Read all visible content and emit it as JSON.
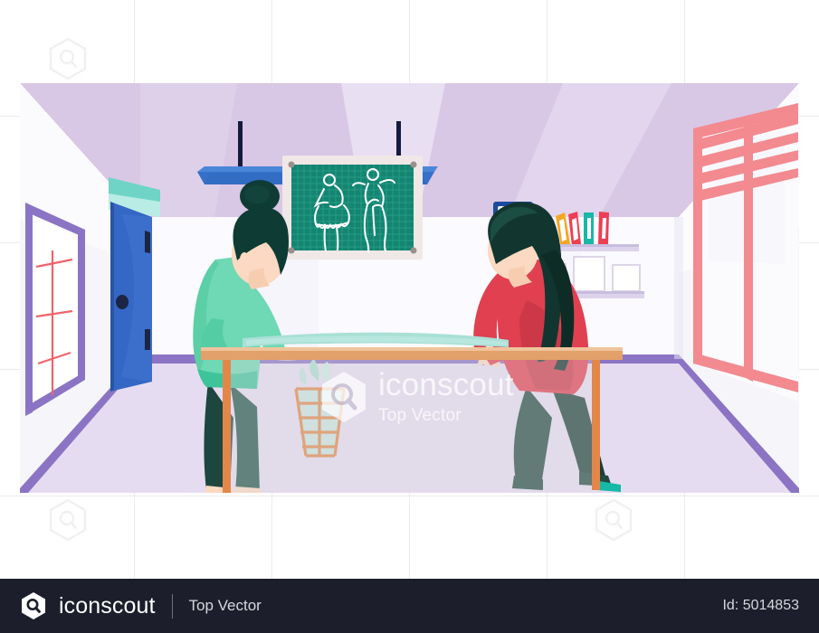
{
  "footer": {
    "logo_icon": "iconscout-hexagon-logo",
    "brand": "iconscout",
    "sub_brand": "Top Vector",
    "id_label": "Id: 5014853"
  },
  "watermark": {
    "logo_icon": "iconscout-hexagon-logo",
    "brand": "iconscout",
    "sub_brand": "Top Vector",
    "tile_icon": "hexagon-magnifier-watermark-icon"
  },
  "illustration": {
    "title": "Fashion design studio with two women at a work table",
    "scene_name": "tailoring-studio-scene",
    "colors": {
      "ceiling": "#d9c7e6",
      "ceiling_light": "#e6dcf0",
      "back_wall": "#fbfbfd",
      "side_wall": "#f4f4f8",
      "floor": "#e2d7ee",
      "floor_trim": "#8b74c4",
      "table_top": "#e2a06a",
      "table_leg": "#e2874a",
      "door": "#3567c4",
      "door_dark": "#2e5bb0",
      "chalkboard": "#1d8f7a",
      "chalkboard_frame": "#efe8e6",
      "window_frame": "#f28a90",
      "lamp": "#3570c9",
      "lamp_rod": "#151b3d",
      "poster_frame": "#8b74c4",
      "poster_marks": "#f0636b",
      "sign": "#7ad9cd"
    },
    "wall_items": [
      {
        "name": "measurement-poster",
        "detail": "purple framed poster with red tick marks"
      },
      {
        "name": "exit-sign",
        "detail": "mint green angled sign above door"
      },
      {
        "name": "studio-door",
        "detail": "blue door with knob and two hinges"
      },
      {
        "name": "design-chalkboard",
        "detail": "teal grid board with two white dress sketches"
      },
      {
        "name": "wall-clock",
        "detail": "square blue framed clock"
      },
      {
        "name": "book-shelf",
        "detail": "shelf with four upright books"
      },
      {
        "name": "frame-shelf",
        "detail": "lower shelf with three white picture frames"
      },
      {
        "name": "studio-window",
        "detail": "pink framed window with blinds"
      },
      {
        "name": "ceiling-lamp",
        "detail": "blue bar lamp on two rods"
      }
    ],
    "books": [
      {
        "name": "book-orange",
        "color": "#f5a623"
      },
      {
        "name": "book-red",
        "color": "#ee3e54"
      },
      {
        "name": "book-teal",
        "color": "#17b8a6"
      },
      {
        "name": "book-crimson",
        "color": "#ee3e54"
      }
    ],
    "people": [
      {
        "name": "designer-left",
        "pose": "standing at table, leaning forward",
        "hair": "#0e3b33",
        "top": "#5fd0ab",
        "bottom": "#1d463f",
        "skin": "#fbd9c2"
      },
      {
        "name": "designer-right",
        "pose": "leaning on table, hand to face",
        "hair": "#12362f",
        "top": "#e0404f",
        "bottom": "#23493f",
        "skin": "#fbd9c2"
      }
    ],
    "table_items": [
      {
        "name": "fabric-roll-on-table",
        "color": "#a9e0d6"
      },
      {
        "name": "fabric-basket",
        "color": "#e2874a"
      }
    ],
    "chalkboard_sketches": [
      {
        "name": "dress-sketch-left"
      },
      {
        "name": "dress-sketch-right"
      }
    ]
  }
}
